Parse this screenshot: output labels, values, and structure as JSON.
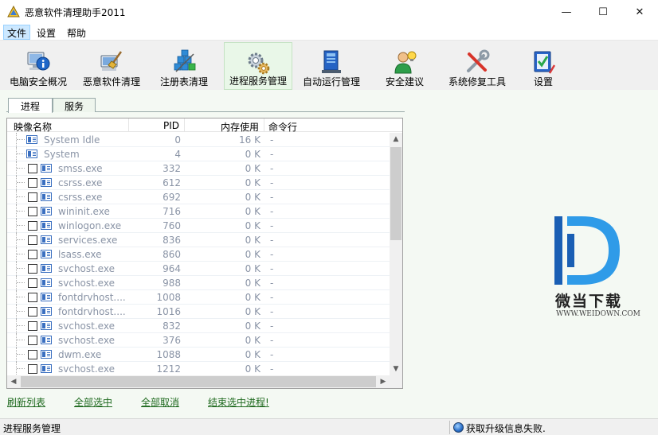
{
  "window": {
    "title": "恶意软件清理助手2011",
    "minimize_glyph": "—",
    "maximize_glyph": "☐",
    "close_glyph": "✕"
  },
  "menu": [
    "文件",
    "设置",
    "帮助"
  ],
  "toolbar": {
    "active_index": 3,
    "items": [
      {
        "label": "电脑安全概况",
        "icon": "info-computer-icon"
      },
      {
        "label": "恶意软件清理",
        "icon": "computer-broom-icon"
      },
      {
        "label": "注册表清理",
        "icon": "registry-cubes-icon"
      },
      {
        "label": "进程服务管理",
        "icon": "gears-icon"
      },
      {
        "label": "自动运行管理",
        "icon": "startup-book-icon"
      },
      {
        "label": "安全建议",
        "icon": "advisor-person-icon"
      },
      {
        "label": "系统修复工具",
        "icon": "repair-tools-icon"
      },
      {
        "label": "设置",
        "icon": "settings-checklist-icon"
      }
    ]
  },
  "tabs": {
    "items": [
      "进程",
      "服务"
    ],
    "active_index": 0
  },
  "process_list": {
    "columns": [
      "映像名称",
      "PID",
      "内存使用",
      "命令行"
    ],
    "rows": [
      {
        "name": "System Idle",
        "pid": "0",
        "mem": "16 K",
        "cmd": "-",
        "checkbox": false
      },
      {
        "name": "System",
        "pid": "4",
        "mem": "0 K",
        "cmd": "-",
        "checkbox": false
      },
      {
        "name": "smss.exe",
        "pid": "332",
        "mem": "0 K",
        "cmd": "-",
        "checkbox": true
      },
      {
        "name": "csrss.exe",
        "pid": "612",
        "mem": "0 K",
        "cmd": "-",
        "checkbox": true
      },
      {
        "name": "csrss.exe",
        "pid": "692",
        "mem": "0 K",
        "cmd": "-",
        "checkbox": true
      },
      {
        "name": "wininit.exe",
        "pid": "716",
        "mem": "0 K",
        "cmd": "-",
        "checkbox": true
      },
      {
        "name": "winlogon.exe",
        "pid": "760",
        "mem": "0 K",
        "cmd": "-",
        "checkbox": true
      },
      {
        "name": "services.exe",
        "pid": "836",
        "mem": "0 K",
        "cmd": "-",
        "checkbox": true
      },
      {
        "name": "lsass.exe",
        "pid": "860",
        "mem": "0 K",
        "cmd": "-",
        "checkbox": true
      },
      {
        "name": "svchost.exe",
        "pid": "964",
        "mem": "0 K",
        "cmd": "-",
        "checkbox": true
      },
      {
        "name": "svchost.exe",
        "pid": "988",
        "mem": "0 K",
        "cmd": "-",
        "checkbox": true
      },
      {
        "name": "fontdrvhost....",
        "pid": "1008",
        "mem": "0 K",
        "cmd": "-",
        "checkbox": true
      },
      {
        "name": "fontdrvhost....",
        "pid": "1016",
        "mem": "0 K",
        "cmd": "-",
        "checkbox": true
      },
      {
        "name": "svchost.exe",
        "pid": "832",
        "mem": "0 K",
        "cmd": "-",
        "checkbox": true
      },
      {
        "name": "svchost.exe",
        "pid": "376",
        "mem": "0 K",
        "cmd": "-",
        "checkbox": true
      },
      {
        "name": "dwm.exe",
        "pid": "1088",
        "mem": "0 K",
        "cmd": "-",
        "checkbox": true
      },
      {
        "name": "svchost.exe",
        "pid": "1212",
        "mem": "0 K",
        "cmd": "-",
        "checkbox": true
      }
    ]
  },
  "scroll_glyphs": {
    "up": "▲",
    "down": "▼",
    "left": "◀",
    "right": "▶"
  },
  "actions": [
    "刷新列表",
    "全部选中",
    "全部取消",
    "结束选中进程!"
  ],
  "watermark": {
    "name": "微当下载",
    "url": "WWW.WEIDOWN.COM",
    "colors": {
      "d_dark": "#1a5fb4",
      "d_light": "#2f9be8"
    }
  },
  "status": {
    "left": "进程服务管理",
    "right": "获取升级信息失败."
  }
}
